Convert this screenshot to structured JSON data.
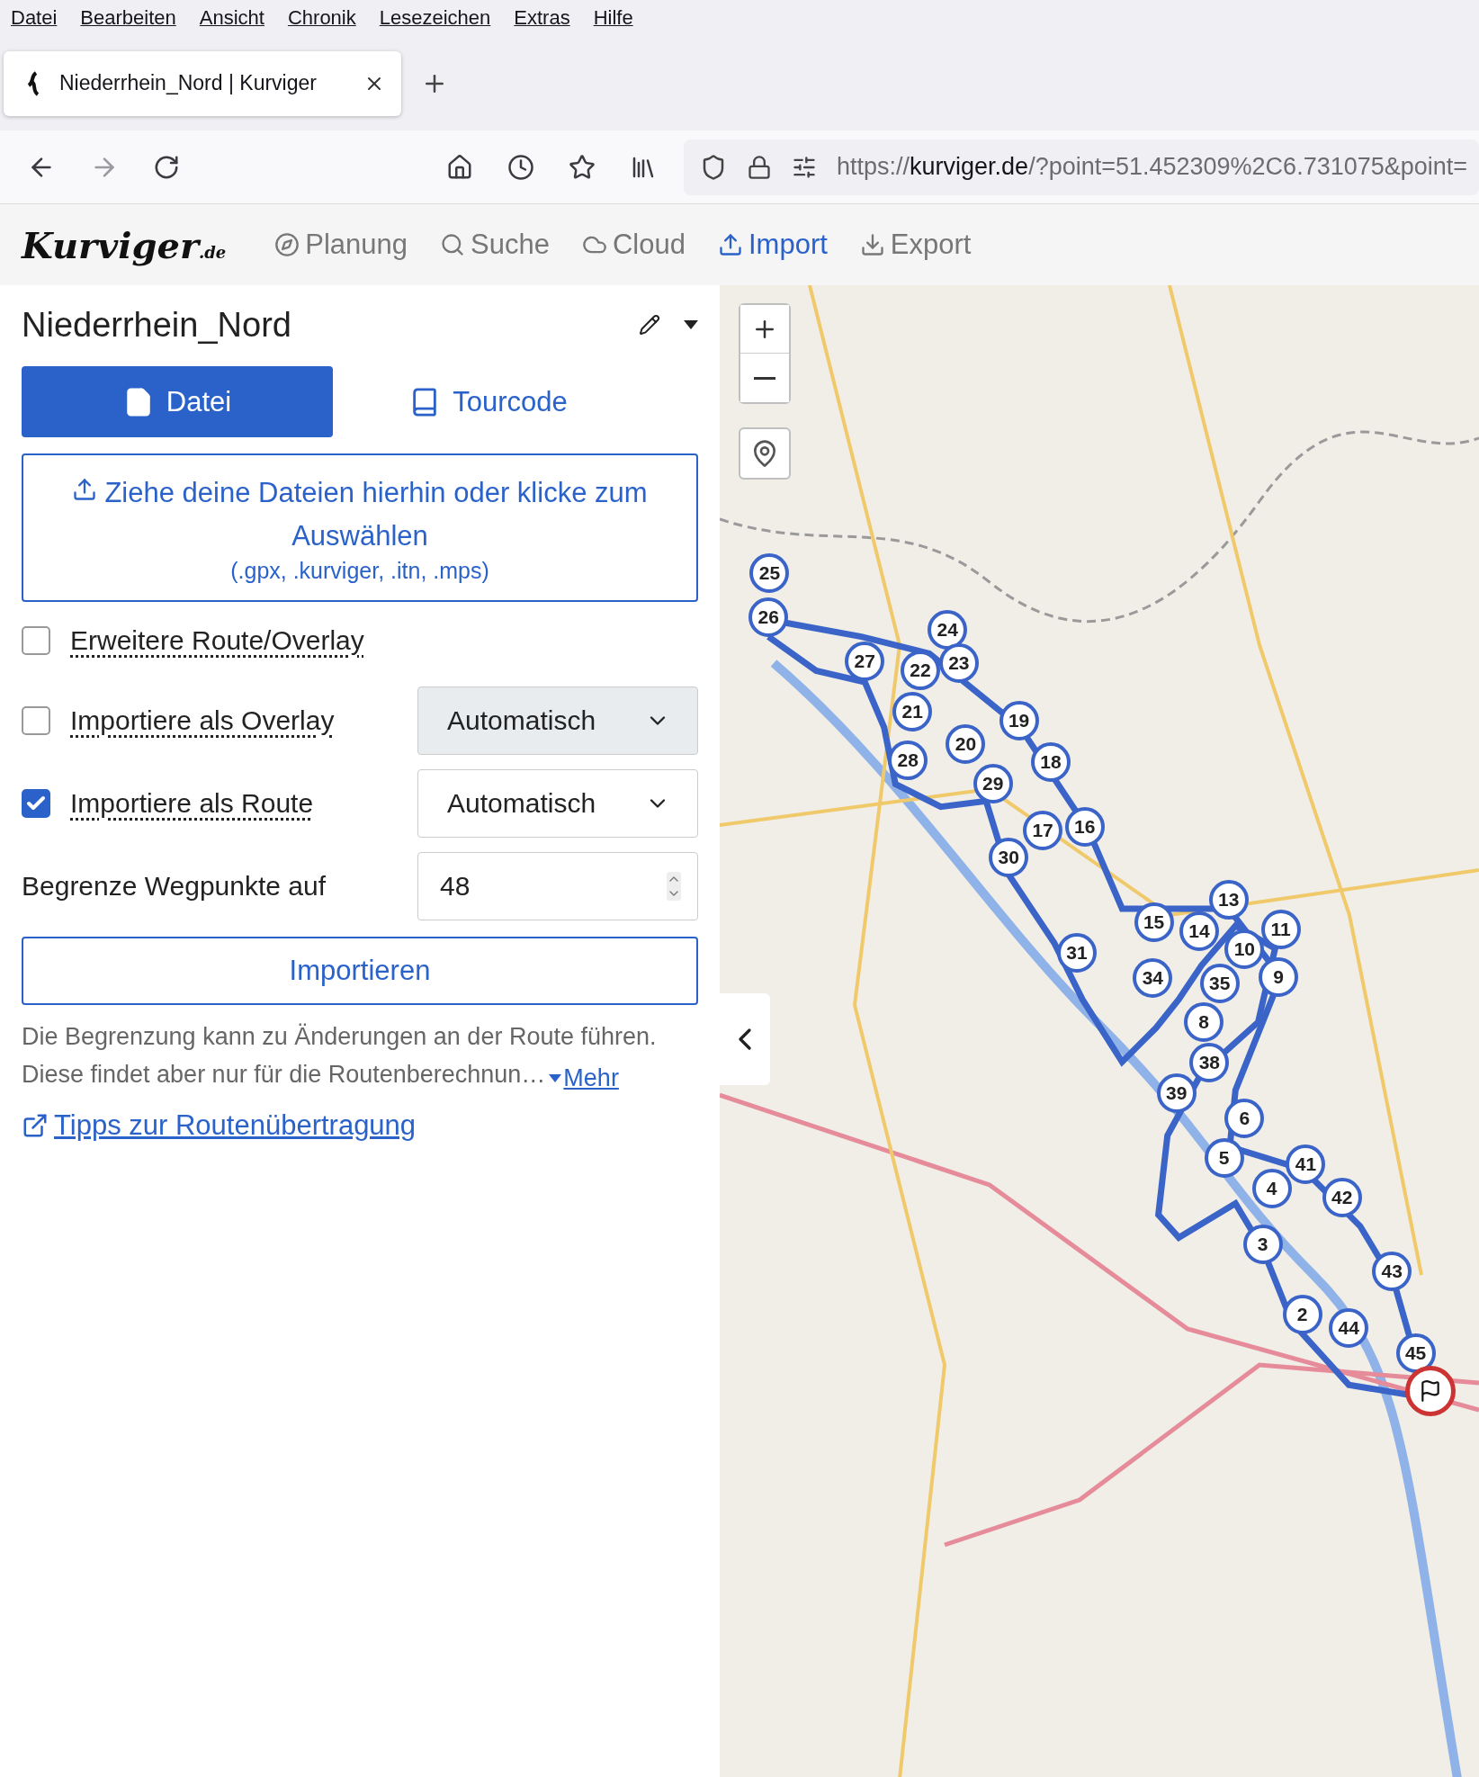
{
  "menu_bar": [
    "Datei",
    "Bearbeiten",
    "Ansicht",
    "Chronik",
    "Lesezeichen",
    "Extras",
    "Hilfe"
  ],
  "browser_tab": {
    "title": "Niederrhein_Nord | Kurviger",
    "selected": true
  },
  "address_bar": {
    "scheme": "https://",
    "host": "kurviger.de",
    "path": "/?point=51.452309%2C6.731075&point="
  },
  "app_header": {
    "logo": "Kurviger",
    "logo_suffix": ".de",
    "nav": [
      {
        "label": "Planung",
        "kind": "compass",
        "selected": false
      },
      {
        "label": "Suche",
        "kind": "search",
        "selected": false
      },
      {
        "label": "Cloud",
        "kind": "cloud",
        "selected": false
      },
      {
        "label": "Import",
        "kind": "upload",
        "selected": true
      },
      {
        "label": "Export",
        "kind": "download",
        "selected": false
      }
    ]
  },
  "panel": {
    "title": "Niederrhein_Nord",
    "tabs": [
      {
        "label": "Datei",
        "kind": "file",
        "selected": true
      },
      {
        "label": "Tourcode",
        "kind": "book",
        "selected": false
      }
    ],
    "dropzone": {
      "text": "Ziehe deine Dateien hierhin oder klicke zum Auswählen",
      "formats": "(.gpx, .kurviger, .itn, .mps)"
    },
    "options": [
      {
        "label": "Erweitere Route/Overlay",
        "checked": false
      },
      {
        "label": "Importiere als Overlay",
        "checked": false,
        "select": "Automatisch"
      },
      {
        "label": "Importiere als Route",
        "checked": true,
        "select": "Automatisch"
      }
    ],
    "limit": {
      "label": "Begrenze Wegpunkte auf",
      "value": "48"
    },
    "button": "Importieren",
    "note_lines": [
      "Die Begrenzung kann zu Änderungen an der Route führen.",
      "Diese findet aber nur für die Routenberechnun…"
    ],
    "more": "Mehr",
    "link": "Tipps zur Routenübertragung"
  },
  "map": {
    "markers": [
      "25",
      "26",
      "24",
      "27",
      "23",
      "22",
      "21",
      "19",
      "20",
      "28",
      "18",
      "29",
      "17",
      "16",
      "30",
      "13",
      "15",
      "14",
      "11",
      "10",
      "31",
      "35",
      "34",
      "9",
      "8",
      "38",
      "39",
      "6",
      "5",
      "41",
      "4",
      "42",
      "3",
      "43",
      "2",
      "44",
      "45"
    ]
  }
}
